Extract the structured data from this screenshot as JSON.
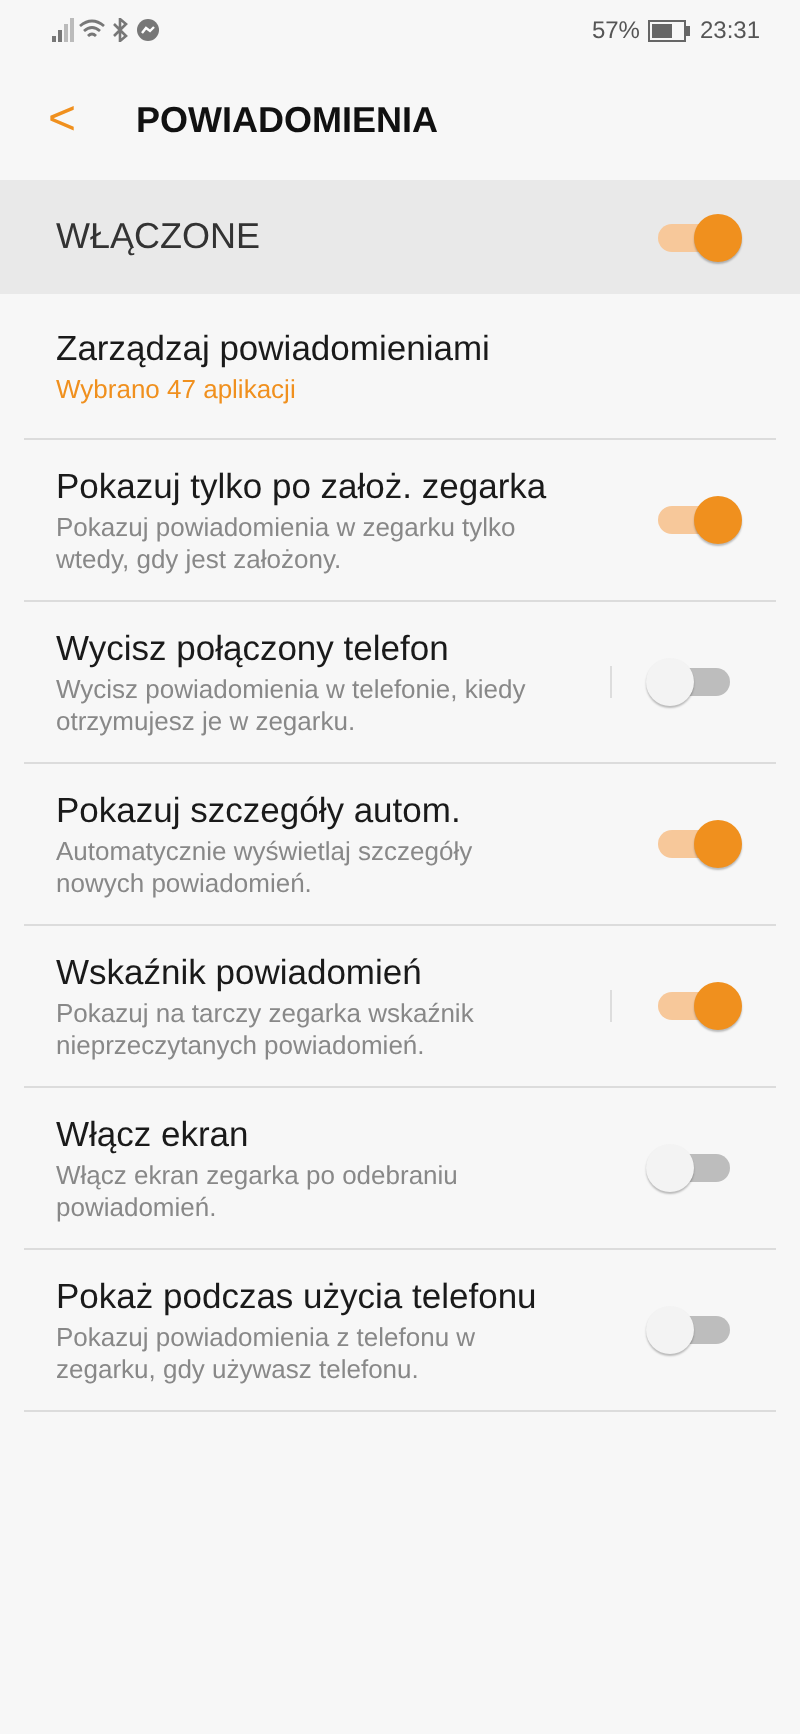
{
  "status_bar": {
    "battery": "57%",
    "time": "23:31"
  },
  "header": {
    "back": "<",
    "title": "POWIADOMIENIA"
  },
  "master": {
    "label": "WŁĄCZONE",
    "on": true
  },
  "items": [
    {
      "kind": "link",
      "title": "Zarządzaj powiadomieniami",
      "subtitle": "Wybrano 47 aplikacji"
    },
    {
      "kind": "switch",
      "title": "Pokazuj tylko po założ. zegarka",
      "subtitle": "Pokazuj powiadomienia w zegarku tylko wtedy, gdy jest założony.",
      "on": true,
      "separator": false
    },
    {
      "kind": "switch",
      "title": "Wycisz połączony telefon",
      "subtitle": "Wycisz powiadomienia w telefonie, kiedy otrzymujesz je w zegarku.",
      "on": false,
      "separator": true
    },
    {
      "kind": "switch",
      "title": "Pokazuj szczegóły autom.",
      "subtitle": "Automatycznie wyświetlaj szczegóły nowych powiadomień.",
      "on": true,
      "separator": false
    },
    {
      "kind": "switch",
      "title": "Wskaźnik powiadomień",
      "subtitle": "Pokazuj na tarczy zegarka wskaźnik nieprzeczytanych powiadomień.",
      "on": true,
      "separator": true
    },
    {
      "kind": "switch",
      "title": "Włącz ekran",
      "subtitle": "Włącz ekran zegarka po odebraniu powiadomień.",
      "on": false,
      "separator": false
    },
    {
      "kind": "switch",
      "title": "Pokaż podczas użycia telefonu",
      "subtitle": "Pokazuj powiadomienia z telefonu w zegarku, gdy używasz telefonu.",
      "on": false,
      "separator": false
    }
  ]
}
